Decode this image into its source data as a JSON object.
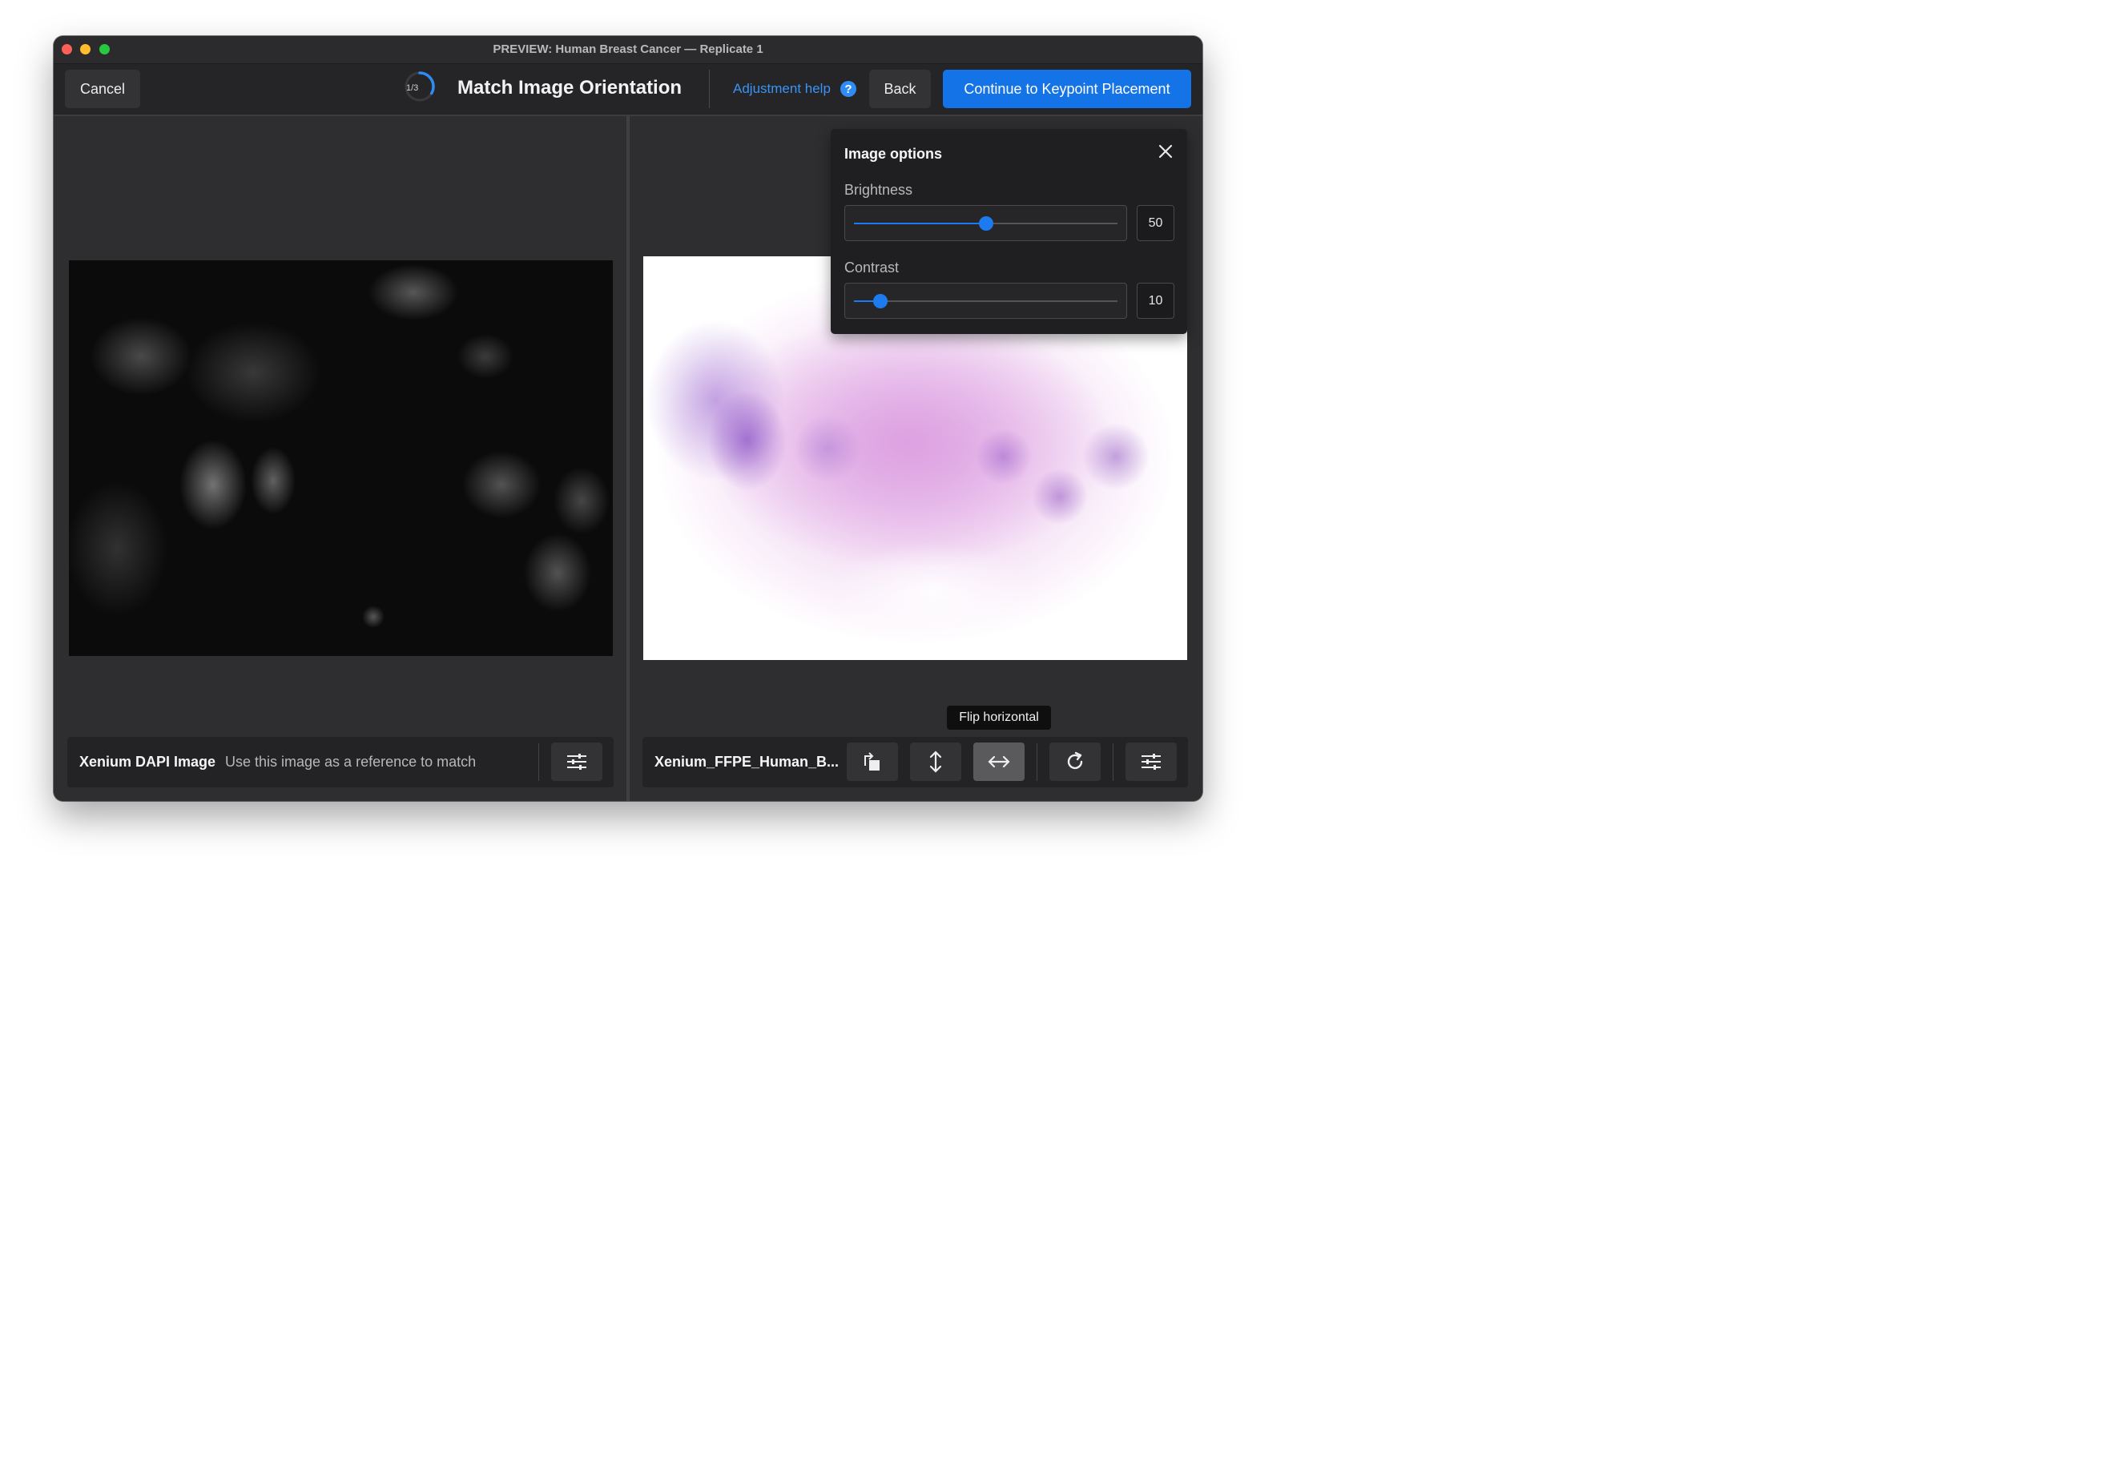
{
  "window": {
    "title": "PREVIEW: Human Breast Cancer — Replicate 1"
  },
  "toolbar": {
    "cancel_label": "Cancel",
    "step_text": "1/3",
    "step_fraction": 0.333,
    "page_title": "Match Image Orientation",
    "help_label": "Adjustment help",
    "help_icon": "question-circle-icon",
    "back_label": "Back",
    "continue_label": "Continue to Keypoint Placement",
    "accent_color": "#1473e6"
  },
  "left_panel": {
    "image_icon": "dapi-fluorescence-image",
    "title": "Xenium DAPI Image",
    "subtitle": "Use this image as a reference to match",
    "settings_icon": "sliders-icon"
  },
  "right_panel": {
    "image_icon": "he-stain-image",
    "title": "Xenium_FFPE_Human_B...",
    "tools": [
      {
        "name": "rotate-square-icon"
      },
      {
        "name": "flip-vertical-icon"
      },
      {
        "name": "flip-horizontal-icon",
        "active": true
      },
      {
        "name": "rotate-clockwise-icon"
      },
      {
        "name": "sliders-icon"
      }
    ],
    "tooltip": "Flip horizontal"
  },
  "image_options": {
    "title": "Image options",
    "brightness": {
      "label": "Brightness",
      "value": "50",
      "fraction": 0.5
    },
    "contrast": {
      "label": "Contrast",
      "value": "10",
      "fraction": 0.1
    }
  }
}
